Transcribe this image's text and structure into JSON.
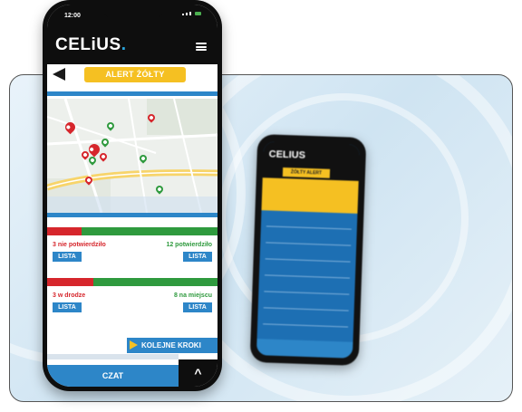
{
  "status": {
    "time": "12:00"
  },
  "app": {
    "logo_text": "CELiUS",
    "logo_dot": "."
  },
  "alert": {
    "label": "ALERT ŻÓŁTY",
    "color": "#f5c022"
  },
  "confirm": {
    "not_confirmed": "3 nie potwierdziło",
    "confirmed": "12 potwierdziło",
    "list_label": "LISTA"
  },
  "location": {
    "on_way": "3 w drodze",
    "on_site": "8 na miejscu",
    "list_label": "LISTA"
  },
  "actions": {
    "next_steps": "KOLEJNE KROKI",
    "chat": "CZAT",
    "chat_toggle": "^"
  },
  "background_phone": {
    "logo_text": "CELIUS",
    "alert_label": "ŻÓŁTY ALERT"
  },
  "colors": {
    "accent_blue": "#2d86c8",
    "red": "#d6262c",
    "green": "#2f9a3e",
    "dark": "#0e0e0e"
  },
  "progress": {
    "confirm_fraction_red": 0.2,
    "location_fraction_red": 0.27
  }
}
